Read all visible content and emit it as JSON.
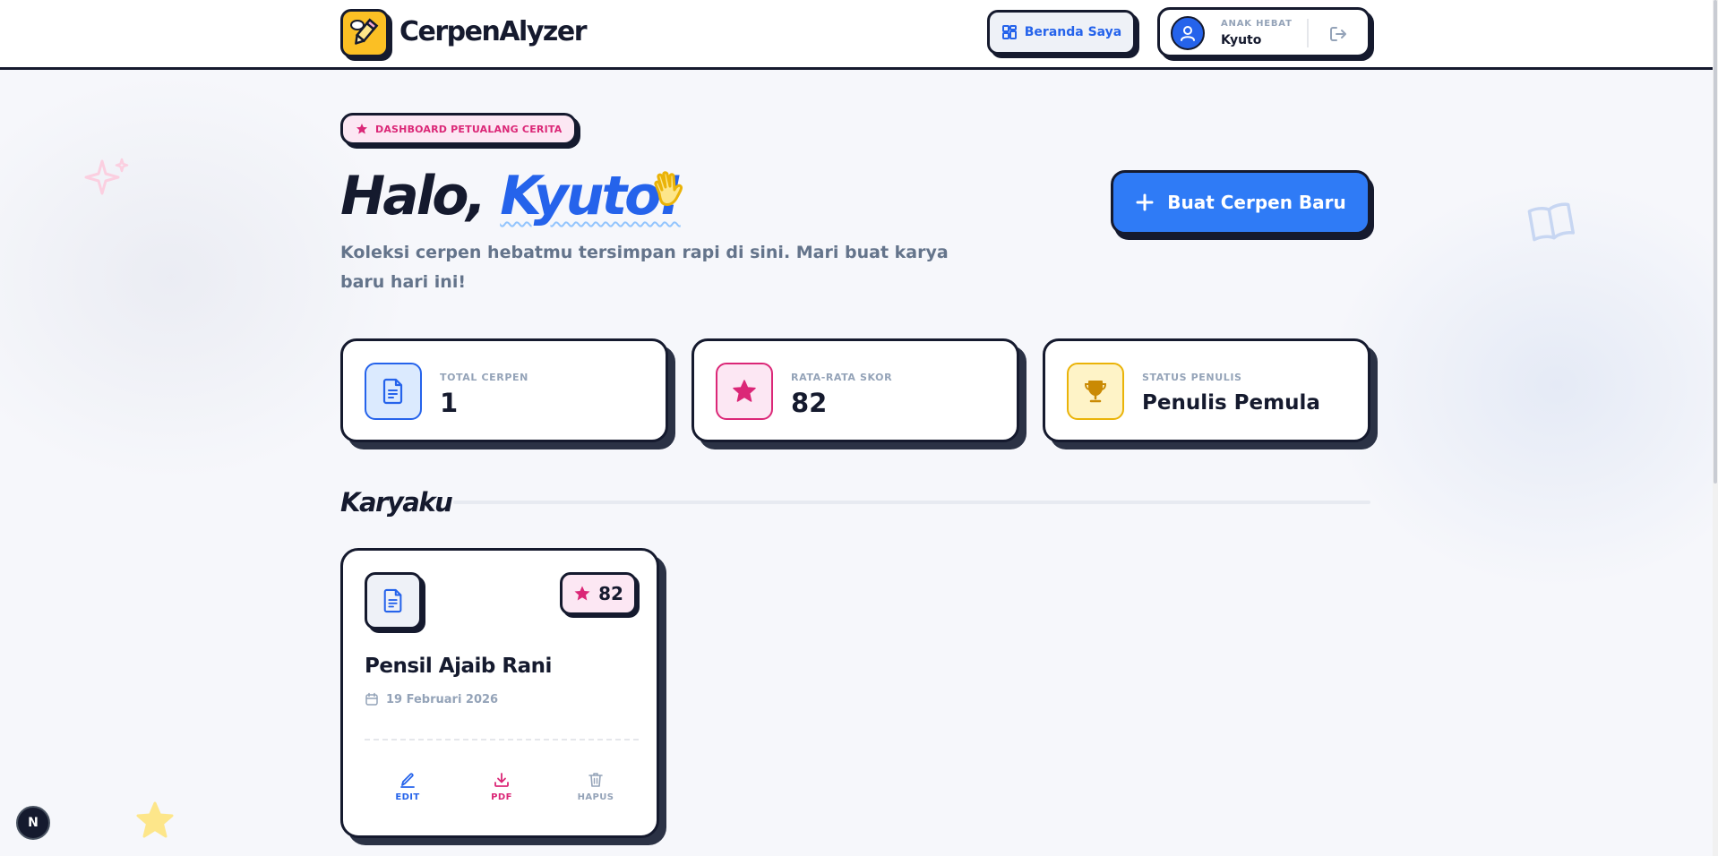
{
  "app": {
    "name": "CerpenAlyzer"
  },
  "header": {
    "home_button_label": "Beranda Saya",
    "user_role": "ANAK HEBAT",
    "user_name": "Kyuto"
  },
  "hero": {
    "badge": "DASHBOARD PETUALANG CERITA",
    "greeting_prefix": "Halo,",
    "greeting_name": "Kyuto!",
    "subtitle": "Koleksi cerpen hebatmu tersimpan rapi di sini. Mari buat karya baru hari ini!",
    "new_story_button": "Buat Cerpen Baru"
  },
  "stats": [
    {
      "label": "TOTAL CERPEN",
      "value": "1",
      "icon": "document-icon",
      "color": "#2563eb"
    },
    {
      "label": "RATA-RATA SKOR",
      "value": "82",
      "icon": "star-icon",
      "color": "#db2777"
    },
    {
      "label": "STATUS PENULIS",
      "value": "Penulis Pemula",
      "icon": "trophy-icon",
      "color": "#ca8a04"
    }
  ],
  "section": {
    "title": "Karyaku"
  },
  "stories": [
    {
      "title": "Pensil Ajaib Rani",
      "date": "19 Februari 2026",
      "score": "82",
      "actions": {
        "edit": "EDIT",
        "pdf": "PDF",
        "delete": "HAPUS"
      }
    }
  ],
  "colors": {
    "primary": "#2563eb",
    "accent_pink": "#db2777",
    "accent_yellow": "#fbbf24",
    "ink": "#151a2e"
  },
  "framework_badge": "N"
}
